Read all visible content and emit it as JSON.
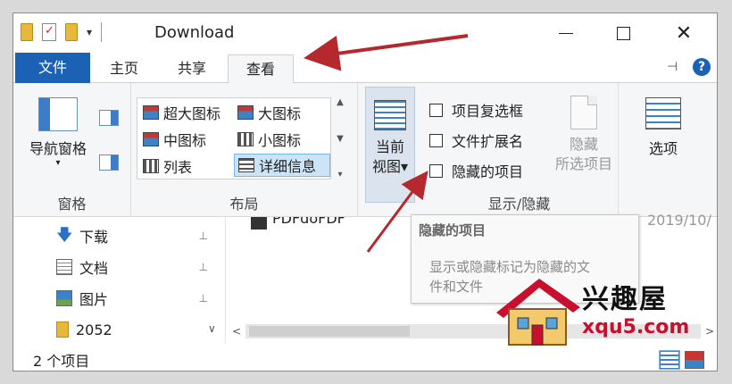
{
  "window": {
    "title": "Download",
    "qat_chevron": "▾",
    "controls": {
      "minimize": "",
      "maximize": "",
      "close": "✕"
    }
  },
  "tabs": {
    "file": "文件",
    "home": "主页",
    "share": "共享",
    "view": "查看",
    "active": "view",
    "pin_icon": "⊣",
    "help": "?"
  },
  "ribbon": {
    "pane": {
      "nav_pane": "导航窗格",
      "nav_pane_chevron": "▾",
      "group_label": "窗格"
    },
    "layout": {
      "items": [
        {
          "label": "超大图标",
          "selected": false
        },
        {
          "label": "大图标",
          "selected": false
        },
        {
          "label": "中图标",
          "selected": false
        },
        {
          "label": "小图标",
          "selected": false
        },
        {
          "label": "列表",
          "selected": false
        },
        {
          "label": "详细信息",
          "selected": true
        }
      ],
      "scroll_up": "▲",
      "scroll_down": "▼",
      "scroll_more": "▾",
      "group_label": "布局"
    },
    "current_view": {
      "line1": "当前",
      "line2": "视图",
      "chevron": "▾"
    },
    "show_hide": {
      "checkboxes": [
        {
          "label": "项目复选框",
          "checked": false
        },
        {
          "label": "文件扩展名",
          "checked": false
        },
        {
          "label": "隐藏的项目",
          "checked": false
        }
      ],
      "hide_selected_line1": "隐藏",
      "hide_selected_line2": "所选项目",
      "group_label": "显示/隐藏"
    },
    "options": {
      "label": "选项"
    }
  },
  "nav": {
    "items": [
      {
        "label": "下载",
        "icon": "download-icon",
        "pinned": true
      },
      {
        "label": "文档",
        "icon": "document-icon",
        "pinned": true
      },
      {
        "label": "图片",
        "icon": "picture-icon",
        "pinned": true
      },
      {
        "label": "2052",
        "icon": "folder-icon",
        "pinned": false
      }
    ],
    "pin_glyph": "📌",
    "scroll_down": "∨"
  },
  "files": {
    "rows": [
      {
        "name": "PDFdoFDF",
        "date": "2019/10/"
      }
    ]
  },
  "tooltip": {
    "title": "隐藏的项目",
    "body_line1": "显示或隐藏标记为隐藏的文",
    "body_line2": "件和文件"
  },
  "hscroll": {
    "left": "<",
    "right": ">"
  },
  "status": {
    "item_count": "2 个项目"
  },
  "watermark": {
    "name": "兴趣屋",
    "url": "xqu5.com"
  },
  "colors": {
    "accent": "#1b62b5",
    "annotation_arrow": "#b5282e",
    "watermark_url": "#c8102e"
  }
}
